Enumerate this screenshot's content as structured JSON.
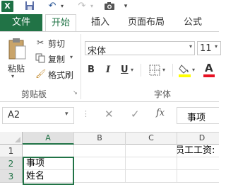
{
  "app": {
    "logo_letter": "X"
  },
  "qat": {
    "save_icon": "save-icon",
    "undo_icon": "undo-icon",
    "redo_icon": "redo-icon",
    "camera_icon": "camera-icon"
  },
  "tabs": [
    {
      "label": "文件",
      "active": false
    },
    {
      "label": "开始",
      "active": true
    },
    {
      "label": "插入",
      "active": false
    },
    {
      "label": "页面布局",
      "active": false
    },
    {
      "label": "公式",
      "active": false
    }
  ],
  "clipboard": {
    "paste_label": "粘贴",
    "cut_label": "剪切",
    "copy_label": "复制",
    "format_painter_label": "格式刷",
    "group_label": "剪贴板"
  },
  "font": {
    "name": "宋体",
    "size": "11",
    "bold": "B",
    "italic": "I",
    "underline": "U",
    "font_color_letter": "A",
    "group_label": "字体",
    "colors": {
      "fill": "#ffff00",
      "font": "#e81123"
    }
  },
  "formula_bar": {
    "name_box": "A2",
    "fx_label": "fx",
    "content": "事项"
  },
  "sheet": {
    "columns": [
      "A",
      "B",
      "C",
      "D"
    ],
    "rows": [
      "1",
      "2",
      "3"
    ],
    "cells": {
      "D1": "员工工资:",
      "A2": "事项",
      "A3": "姓名"
    }
  },
  "accent": "#217346"
}
